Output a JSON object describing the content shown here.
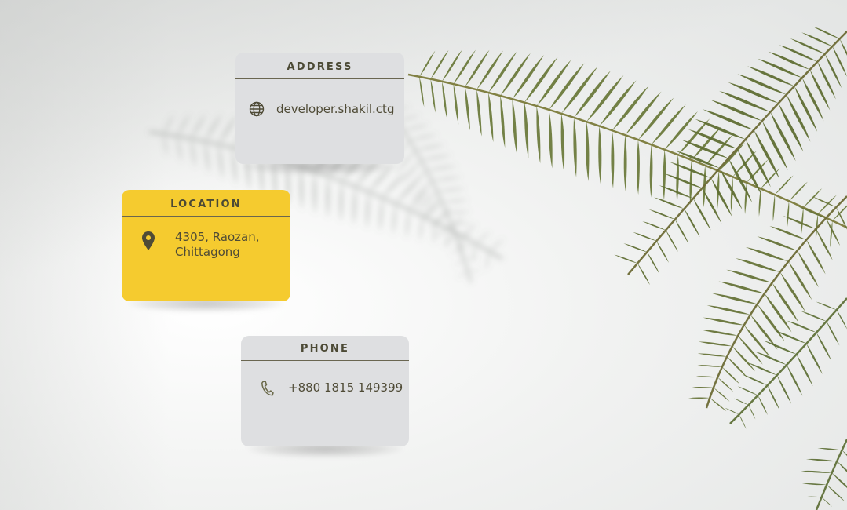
{
  "cards": {
    "address": {
      "title": "ADDRESS",
      "value": "developer.shakil.ctg",
      "icon": "globe-icon"
    },
    "location": {
      "title": "LOCATION",
      "value_line1": "4305, Raozan,",
      "value_line2": "Chittagong",
      "icon": "map-pin-icon"
    },
    "phone": {
      "title": "PHONE",
      "value": "+880 1815 149399",
      "icon": "phone-icon"
    }
  },
  "colors": {
    "card_gray": "#dedfe1",
    "card_yellow": "#f5cb2f",
    "text_olive": "#4f4b36",
    "fern_green": "#6b7a3c"
  },
  "background": {
    "decoration": "fern-leaf-image"
  }
}
